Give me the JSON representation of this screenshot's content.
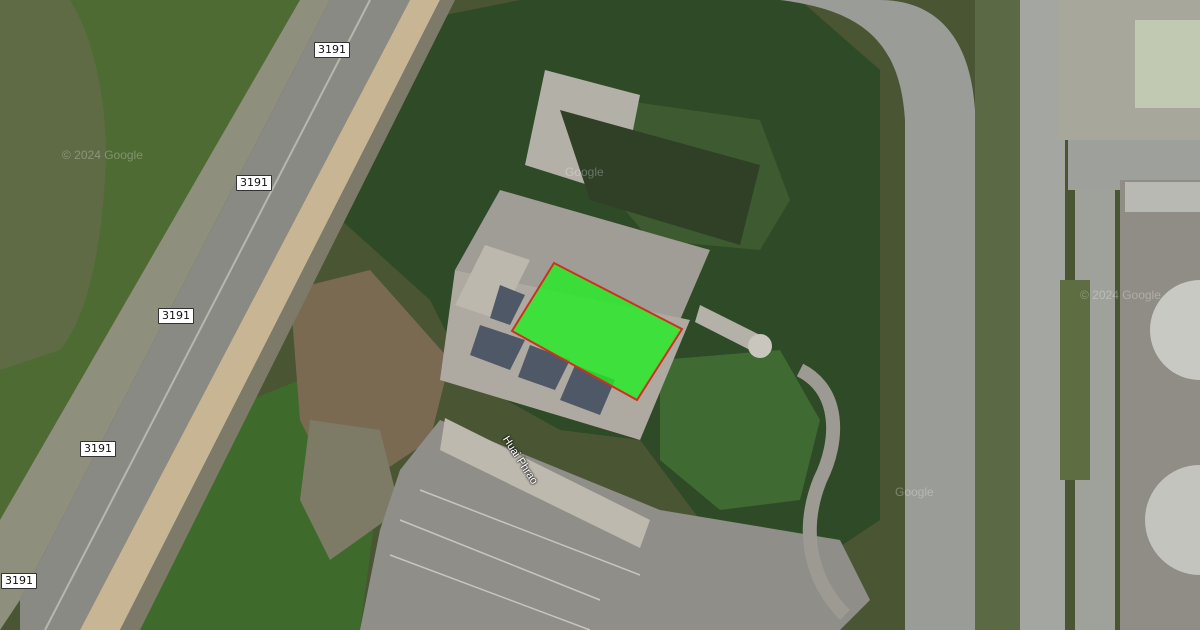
{
  "map": {
    "route_shields": [
      "3191",
      "3191",
      "3191",
      "3191",
      "3191"
    ],
    "road_name": "Huai Phrao",
    "watermarks": [
      "© 2024 Google",
      "Google",
      "© 2024 Google",
      "Google"
    ],
    "highlight": {
      "fill": "#22ee22",
      "stroke": "#d22f1f",
      "opacity": 0.8
    }
  }
}
